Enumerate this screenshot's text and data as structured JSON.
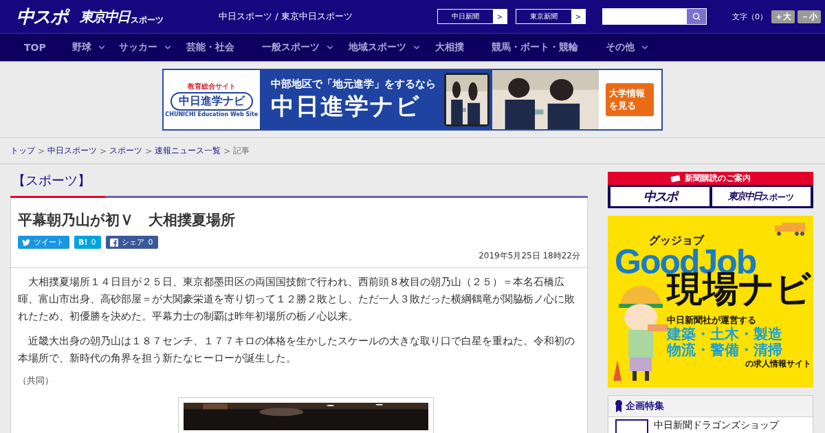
{
  "header": {
    "logo_main": "中スポ",
    "logo_tokyo": "東京中日",
    "logo_tokyo_small": "スポーツ",
    "site_names": "中日スポーツ / 東京中日スポーツ",
    "paper_links": [
      {
        "label": "中日新聞",
        "arrow": ">"
      },
      {
        "label": "東京新聞",
        "arrow": ">"
      }
    ],
    "font_size": {
      "label": "文字（0）",
      "buttons": [
        "＋大",
        "－小"
      ]
    }
  },
  "nav": [
    {
      "label": "TOP",
      "dropdown": false
    },
    {
      "label": "野球",
      "dropdown": true
    },
    {
      "label": "サッカー",
      "dropdown": true
    },
    {
      "label": "芸能・社会",
      "dropdown": false
    },
    {
      "label": "一般スポーツ",
      "dropdown": true
    },
    {
      "label": "地域スポーツ",
      "dropdown": true
    },
    {
      "label": "大相撲",
      "dropdown": false
    },
    {
      "label": "競馬・ボート・競輪",
      "dropdown": false
    },
    {
      "label": "その他",
      "dropdown": true
    }
  ],
  "top_ad": {
    "logo_caption": "教育総合サイト",
    "logo": "中日進学ナビ",
    "logo_sub": "CHUNICHI Education Web Site",
    "tagline": "中部地区で「地元進学」をするなら",
    "title": "中日進学ナビ",
    "cta": "大学情報を見る"
  },
  "breadcrumb": [
    {
      "label": "トップ",
      "link": true
    },
    {
      "label": "中日スポーツ",
      "link": true
    },
    {
      "label": "スポーツ",
      "link": true
    },
    {
      "label": "速報ニュース一覧",
      "link": true
    },
    {
      "label": "記事",
      "link": false
    }
  ],
  "section_title": "【スポーツ】",
  "article": {
    "title": "平幕朝乃山が初Ｖ　大相撲夏場所",
    "share": [
      {
        "kind": "twitter",
        "label": "ツイート"
      },
      {
        "kind": "hatena",
        "label": "B!",
        "count": "0"
      },
      {
        "kind": "facebook",
        "label": "シェア",
        "count": "0"
      }
    ],
    "date": "2019年5月25日 18時22分",
    "paragraphs": [
      "　大相撲夏場所１４日目が２５日、東京都墨田区の両国国技館で行われ、西前頭８枚目の朝乃山（２５）＝本名石橋広暉、富山市出身、高砂部屋＝が大関豪栄道を寄り切って１２勝２敗とし、ただ一人３敗だった横綱鶴竜が関脇栃ノ心に敗れたため、初優勝を決めた。平幕力士の制覇は昨年初場所の栃ノ心以来。",
      "　近畿大出身の朝乃山は１８７センチ、１７７キロの体格を生かしたスケールの大きな取り口で白星を重ねた。令和初の本場所で、新時代の角界を担う新たなヒーローが誕生した。"
    ],
    "credit": "（共同）",
    "photo": {
      "kind": "picture"
    }
  },
  "sidebar": {
    "subscribe": {
      "heading": "新聞購読のご案内",
      "logos": [
        {
          "main": "中スポ"
        },
        {
          "main": "東京中日",
          "small": "スポーツ"
        }
      ]
    },
    "job_ad": {
      "kana": "グッジョブ",
      "brand": "GoodJob",
      "title": "現場ナビ",
      "operator": "中日新聞社が運営する",
      "lines": [
        "建築・土木・製造",
        "物流・警備・清掃"
      ],
      "footer": "の求人情報サイト"
    },
    "features": {
      "heading": "企画特集",
      "items": [
        "中日新聞ドラゴンズショップ"
      ]
    }
  }
}
